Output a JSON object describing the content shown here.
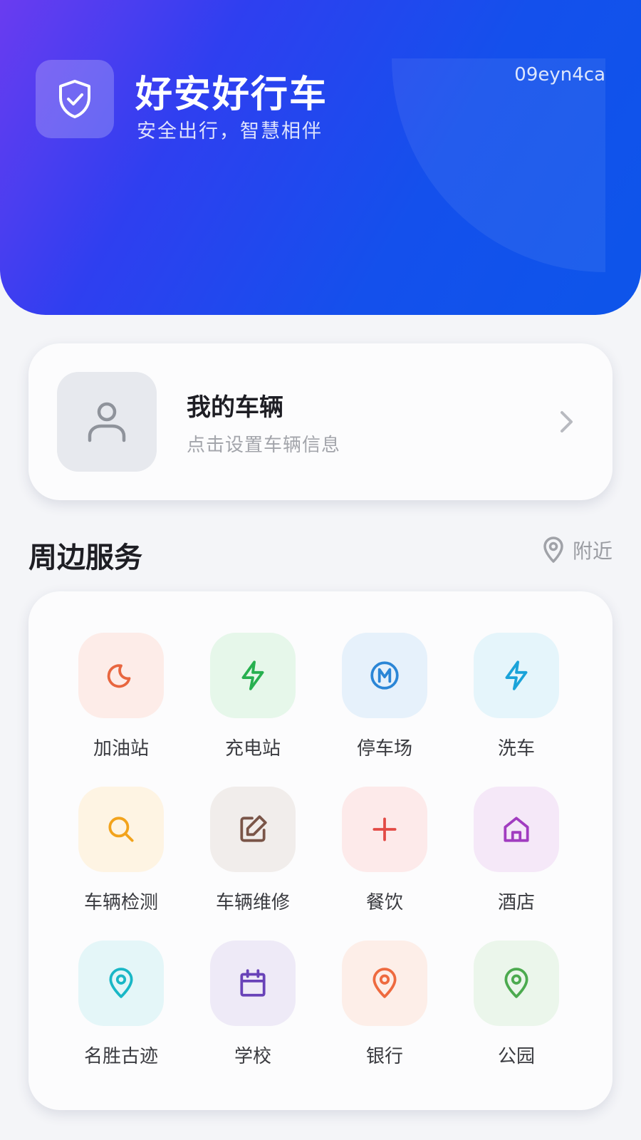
{
  "header": {
    "title": "好安好行车",
    "slogan": "安全出行，智慧相伴",
    "code": "09eyn4ca",
    "logo_icon": "shield-check-icon"
  },
  "vehicle": {
    "title": "我的车辆",
    "subtitle": "点击设置车辆信息",
    "avatar_icon": "user-icon",
    "arrow_icon": "chevron-right-icon"
  },
  "services": {
    "title": "周边服务",
    "nearby_label": "附近",
    "items": [
      {
        "label": "加油站",
        "icon": "moon-icon",
        "color": "#e8663f",
        "bg": "#fdece8"
      },
      {
        "label": "充电站",
        "icon": "lightning-icon",
        "color": "#27b04f",
        "bg": "#e6f7ea"
      },
      {
        "label": "停车场",
        "icon": "metro-icon",
        "color": "#2b86d6",
        "bg": "#e6f1fb"
      },
      {
        "label": "洗车",
        "icon": "lightning-icon",
        "color": "#1aa3d9",
        "bg": "#e5f5fb"
      },
      {
        "label": "车辆检测",
        "icon": "search-icon",
        "color": "#f2a31c",
        "bg": "#fef4e3"
      },
      {
        "label": "车辆维修",
        "icon": "edit-icon",
        "color": "#7a5548",
        "bg": "#f1edeb"
      },
      {
        "label": "餐饮",
        "icon": "plus-icon",
        "color": "#e24a45",
        "bg": "#fdeaea"
      },
      {
        "label": "酒店",
        "icon": "home-icon",
        "color": "#a13cc0",
        "bg": "#f5e8f8"
      },
      {
        "label": "名胜古迹",
        "icon": "location-pin-icon",
        "color": "#19b7c6",
        "bg": "#e4f6f8"
      },
      {
        "label": "学校",
        "icon": "calendar-icon",
        "color": "#6842b8",
        "bg": "#eeeaf7"
      },
      {
        "label": "银行",
        "icon": "location-pin-icon",
        "color": "#ee6a3f",
        "bg": "#fdeee8"
      },
      {
        "label": "公园",
        "icon": "location-pin-icon",
        "color": "#4caa4f",
        "bg": "#ebf6eb"
      }
    ]
  }
}
